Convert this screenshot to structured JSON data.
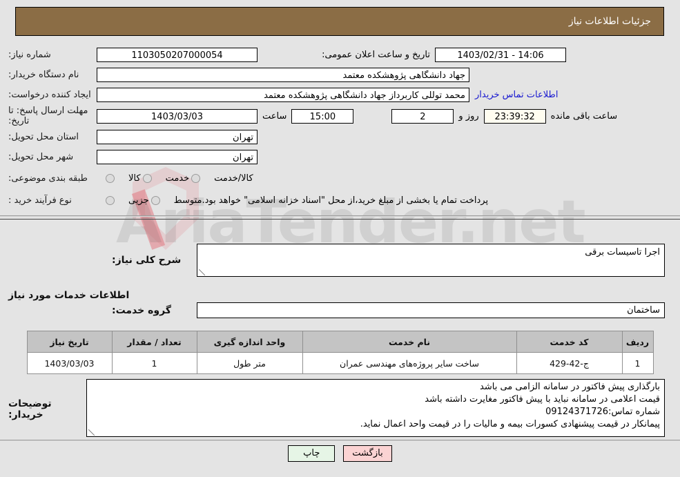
{
  "header": {
    "title": "جزئیات اطلاعات نیاز",
    "bar_color": "#8b6d45"
  },
  "form": {
    "need_number_label": "شماره نیاز:",
    "need_number_value": "1103050207000054",
    "public_announce_label": "تاریخ و ساعت اعلان عمومی:",
    "public_announce_value": "14:06 - 1403/02/31",
    "buyer_org_label": "نام دستگاه خریدار:",
    "buyer_org_value": "جهاد دانشگاهی پژوهشکده معتمد",
    "creator_label": "ایجاد کننده درخواست:",
    "creator_value": "محمد توللی کاربرداز جهاد دانشگاهی پژوهشکده معتمد",
    "contact_link": "اطلاعات تماس خریدار",
    "deadline_label": "مهلت ارسال پاسخ: تا تاریخ:",
    "deadline_date": "1403/03/03",
    "hour_label": "ساعت",
    "deadline_time": "15:00",
    "days_value": "2",
    "days_label": "روز و",
    "countdown_value": "23:39:32",
    "countdown_label": "ساعت باقی مانده",
    "province_label": "استان محل تحویل:",
    "province_value": "تهران",
    "city_label": "شهر محل تحویل:",
    "city_value": "تهران",
    "category_label": "طبقه بندی موضوعی:",
    "category_options": [
      {
        "label": "کالا",
        "selected": false
      },
      {
        "label": "خدمت",
        "selected": false
      },
      {
        "label": "کالا/خدمت",
        "selected": false
      }
    ],
    "process_label": "نوع فرآیند خرید :",
    "process_options": [
      {
        "label": "جزیی",
        "selected": false
      },
      {
        "label": "متوسط",
        "selected": false
      }
    ],
    "treasury_note": "پرداخت تمام یا بخشی از مبلغ خرید،از محل \"اسناد خزانه اسلامی\" خواهد بود."
  },
  "description": {
    "general_label": "شرح کلی نیاز:",
    "general_value": "اجرا تاسیسات برقی",
    "section_title": "اطلاعات خدمات مورد نیاز",
    "service_group_label": "گروه خدمت:",
    "service_group_value": "ساختمان"
  },
  "table": {
    "columns": [
      "ردیف",
      "کد خدمت",
      "نام خدمت",
      "واحد اندازه گیری",
      "تعداد / مقدار",
      "تاریخ نیاز"
    ],
    "rows": [
      {
        "index": "1",
        "code": "ج-42-429",
        "name": "ساخت سایر پروژه‌های مهندسی عمران",
        "unit": "متر طول",
        "quantity": "1",
        "need_date": "1403/03/03"
      }
    ]
  },
  "buyer_notes": {
    "label": "توضیحات خریدار:",
    "lines": [
      "بارگذاری پیش فاکتور در سامانه الزامی می باشد",
      "قیمت اعلامی در سامانه نباید با پیش فاکتور مغایرت داشته باشد",
      "شماره تماس:09124371726",
      "پیمانکار در قیمت پیشنهادی کسورات بیمه و مالیات را در قیمت واحد اعمال نماید."
    ]
  },
  "buttons": {
    "print": "چاپ",
    "back": "بازگشت"
  },
  "watermark": {
    "text": "AriaTender.net"
  }
}
